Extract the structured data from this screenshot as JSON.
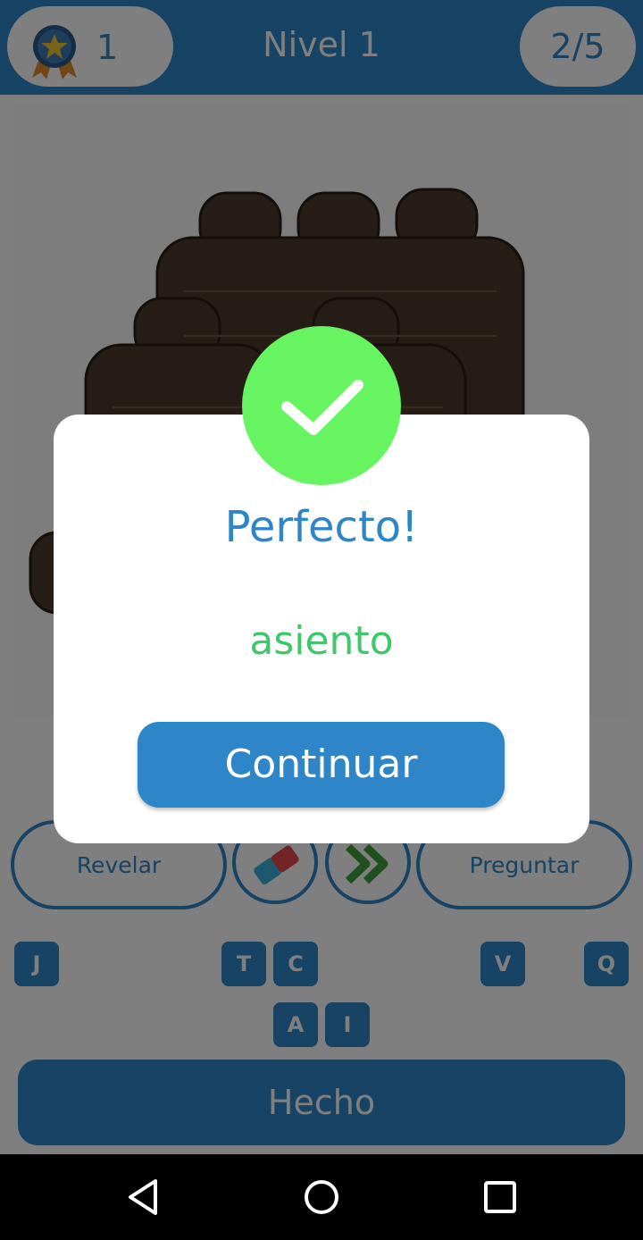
{
  "header": {
    "score": "1",
    "level_title": "Nivel 1",
    "progress": "2/5",
    "medal_icon": "star-medal-icon"
  },
  "hints": {
    "reveal_label": "Revelar",
    "ask_label": "Preguntar",
    "eraser_icon": "eraser-icon",
    "skip_icon": "double-chevron-right-icon"
  },
  "letters": {
    "row1": [
      "J",
      "T",
      "C",
      "V",
      "Q"
    ],
    "row2": [
      "A",
      "I"
    ]
  },
  "done_label": "Hecho",
  "dialog": {
    "title": "Perfecto!",
    "answer": "asiento",
    "continue_label": "Continuar",
    "check_color": "#66f560"
  },
  "colors": {
    "brand_blue": "#2e86c8",
    "answer_green": "#3fc76a"
  },
  "navbar": {
    "back_icon": "back-triangle-icon",
    "home_icon": "home-circle-icon",
    "recents_icon": "recents-square-icon"
  }
}
